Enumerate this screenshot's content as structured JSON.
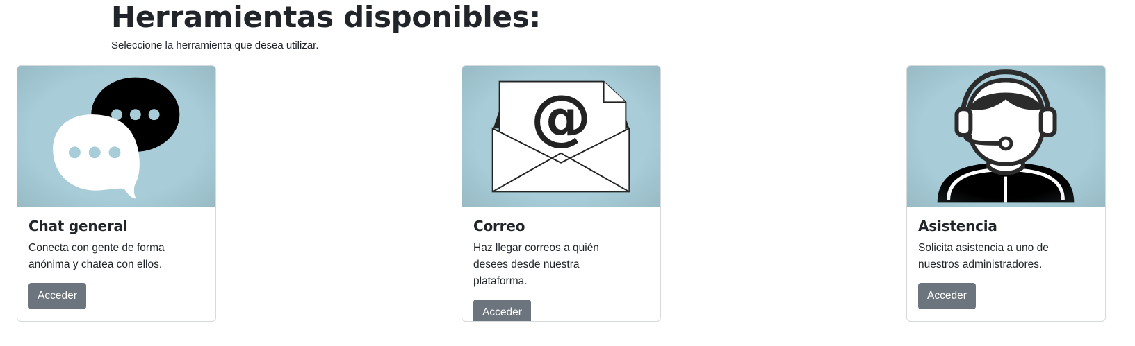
{
  "header": {
    "title": "Herramientas disponibles:",
    "subtitle": "Seleccione la herramienta que desea utilizar."
  },
  "colors": {
    "card_image_bg": "#a8cdd8",
    "button_bg": "#6c757d",
    "text": "#212529"
  },
  "cards": [
    {
      "icon": "chat-bubbles-icon",
      "title": "Chat general",
      "text": "Conecta con gente de forma anónima y chatea con ellos.",
      "button": "Acceder"
    },
    {
      "icon": "email-envelope-icon",
      "title": "Correo",
      "text": "Haz llegar correos a quién desees desde nuestra plataforma.",
      "button": "Acceder"
    },
    {
      "icon": "support-agent-icon",
      "title": "Asistencia",
      "text": "Solicita asistencia a uno de nuestros administradores.",
      "button": "Acceder"
    }
  ]
}
